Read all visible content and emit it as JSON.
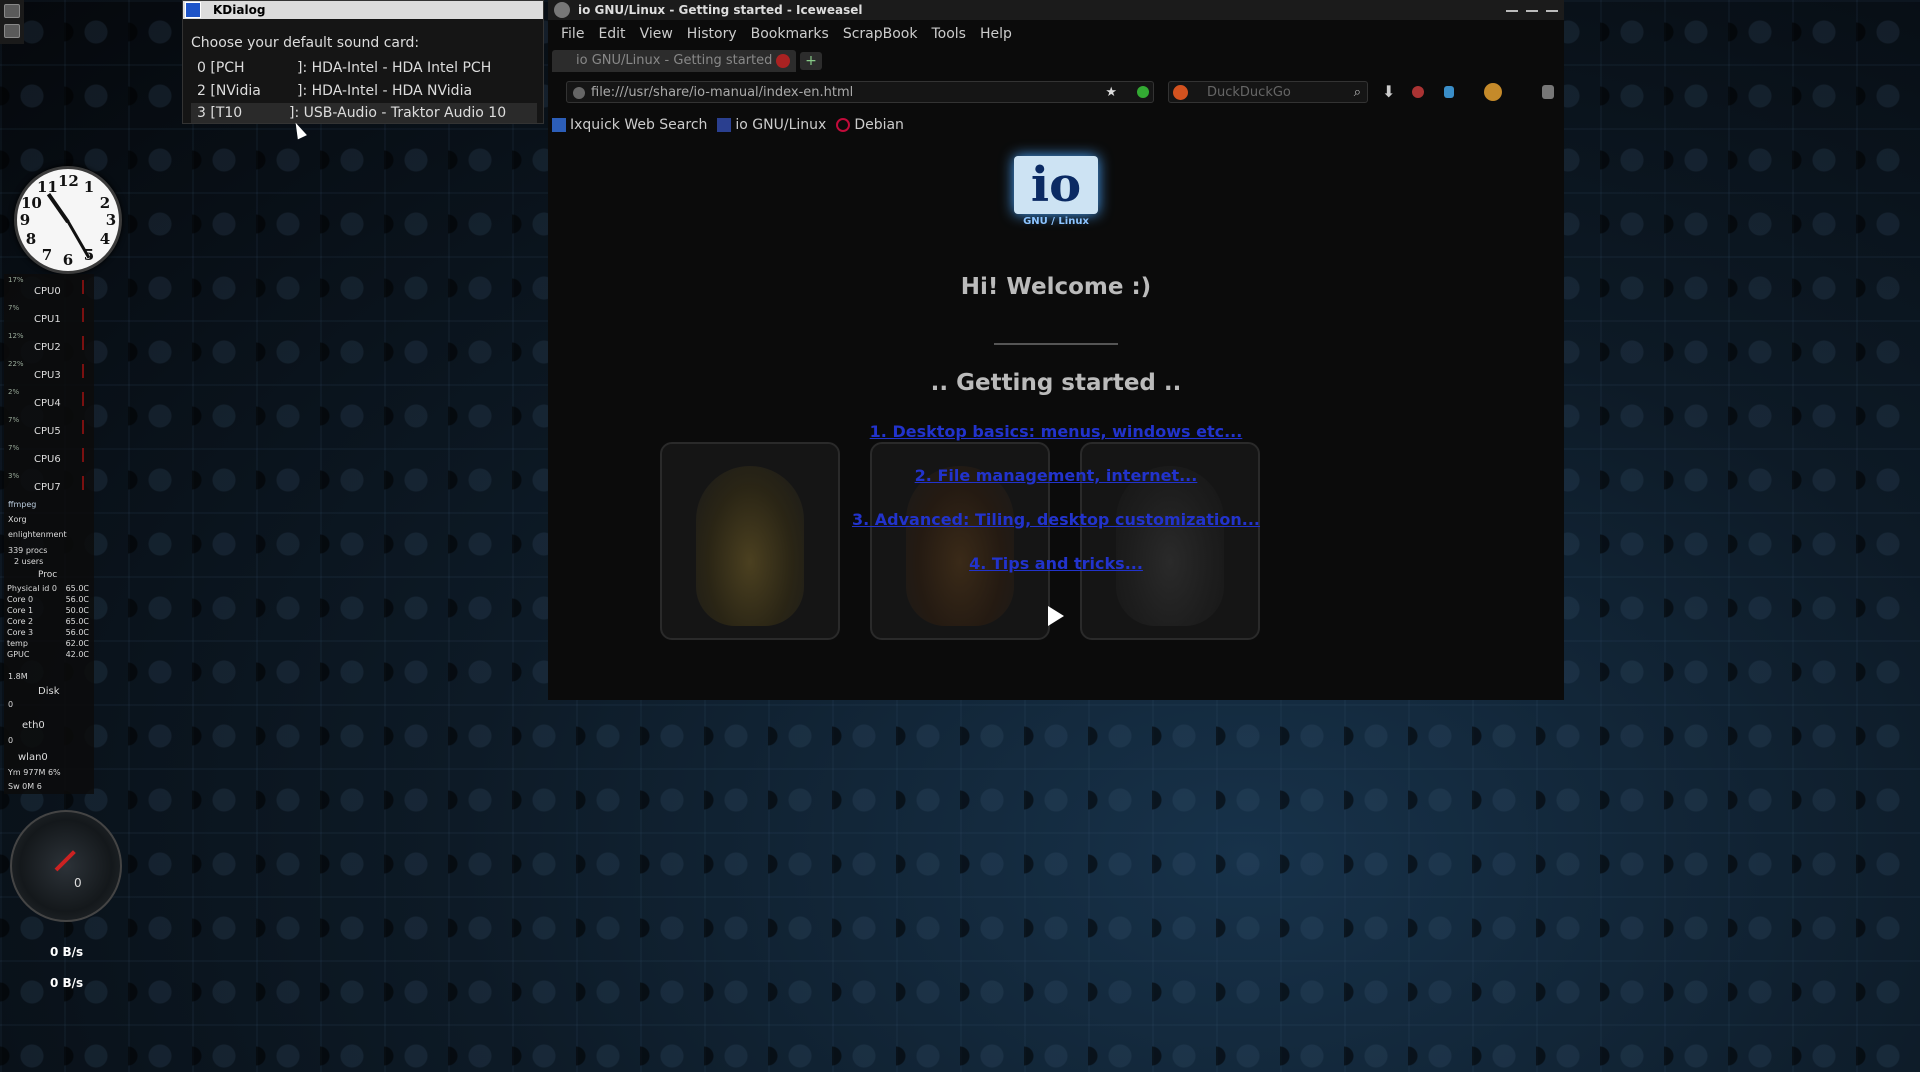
{
  "kdialog": {
    "title": "KDialog",
    "prompt": "Choose your default sound card:",
    "items": [
      {
        "id": "0 [PCH",
        "desc": "]: HDA-Intel - HDA Intel PCH"
      },
      {
        "id": "2 [NVidia",
        "desc": "]: HDA-Intel - HDA NVidia"
      },
      {
        "id": "3 [T10",
        "desc": "]: USB-Audio - Traktor Audio 10",
        "selected": true
      }
    ]
  },
  "browser": {
    "window_title": "io GNU/Linux - Getting started - Iceweasel",
    "menu": [
      "File",
      "Edit",
      "View",
      "History",
      "Bookmarks",
      "ScrapBook",
      "Tools",
      "Help"
    ],
    "tab_title": "io GNU/Linux - Getting started",
    "url": "file:///usr/share/io-manual/index-en.html",
    "search_placeholder": "DuckDuckGo",
    "bookmarks": [
      "Ixquick Web Search",
      "io GNU/Linux",
      "Debian"
    ],
    "page": {
      "logo_text": "io",
      "logo_sub": "GNU / Linux",
      "welcome": "Hi! Welcome :)",
      "subtitle": ".. Getting started ..",
      "links": [
        "1. Desktop basics: menus, windows etc...",
        "2. File management, internet...",
        "3. Advanced: Tiling, desktop customization...",
        "4. Tips and tricks..."
      ]
    }
  },
  "system_monitor": {
    "cpus": [
      {
        "name": "CPU0",
        "pct": "17%"
      },
      {
        "name": "CPU1",
        "pct": "7%"
      },
      {
        "name": "CPU2",
        "pct": "12%"
      },
      {
        "name": "CPU3",
        "pct": "22%"
      },
      {
        "name": "CPU4",
        "pct": "2%"
      },
      {
        "name": "CPU5",
        "pct": "7%"
      },
      {
        "name": "CPU6",
        "pct": "7%"
      },
      {
        "name": "CPU7",
        "pct": "3%"
      }
    ],
    "processes": [
      "ffmpeg",
      "Xorg",
      "enlightenment"
    ],
    "procs_count": "339 procs",
    "users": "2 users",
    "sensors_title": "Proc",
    "sensors": [
      {
        "label": "Physical id 0",
        "value": "65.0C"
      },
      {
        "label": "Core 0",
        "value": "56.0C"
      },
      {
        "label": "Core 1",
        "value": "50.0C"
      },
      {
        "label": "Core 2",
        "value": "65.0C"
      },
      {
        "label": "Core 3",
        "value": "56.0C"
      },
      {
        "label": "temp",
        "value": "62.0C"
      },
      {
        "label": "GPUC",
        "value": "42.0C"
      }
    ],
    "disk_value": "1.8M",
    "disk_label": "Disk",
    "eth_value": "0",
    "eth_label": "eth0",
    "wlan_value": "0",
    "wlan_label": "wlan0",
    "ram": "Ym 977M 6%",
    "swap": "Sw  0M 6",
    "gauge_value": "0",
    "net_down": "0 B/s",
    "net_up": "0 B/s"
  },
  "colors": {
    "link": "#2233cc",
    "accent_glow": "#4aa6ff"
  }
}
